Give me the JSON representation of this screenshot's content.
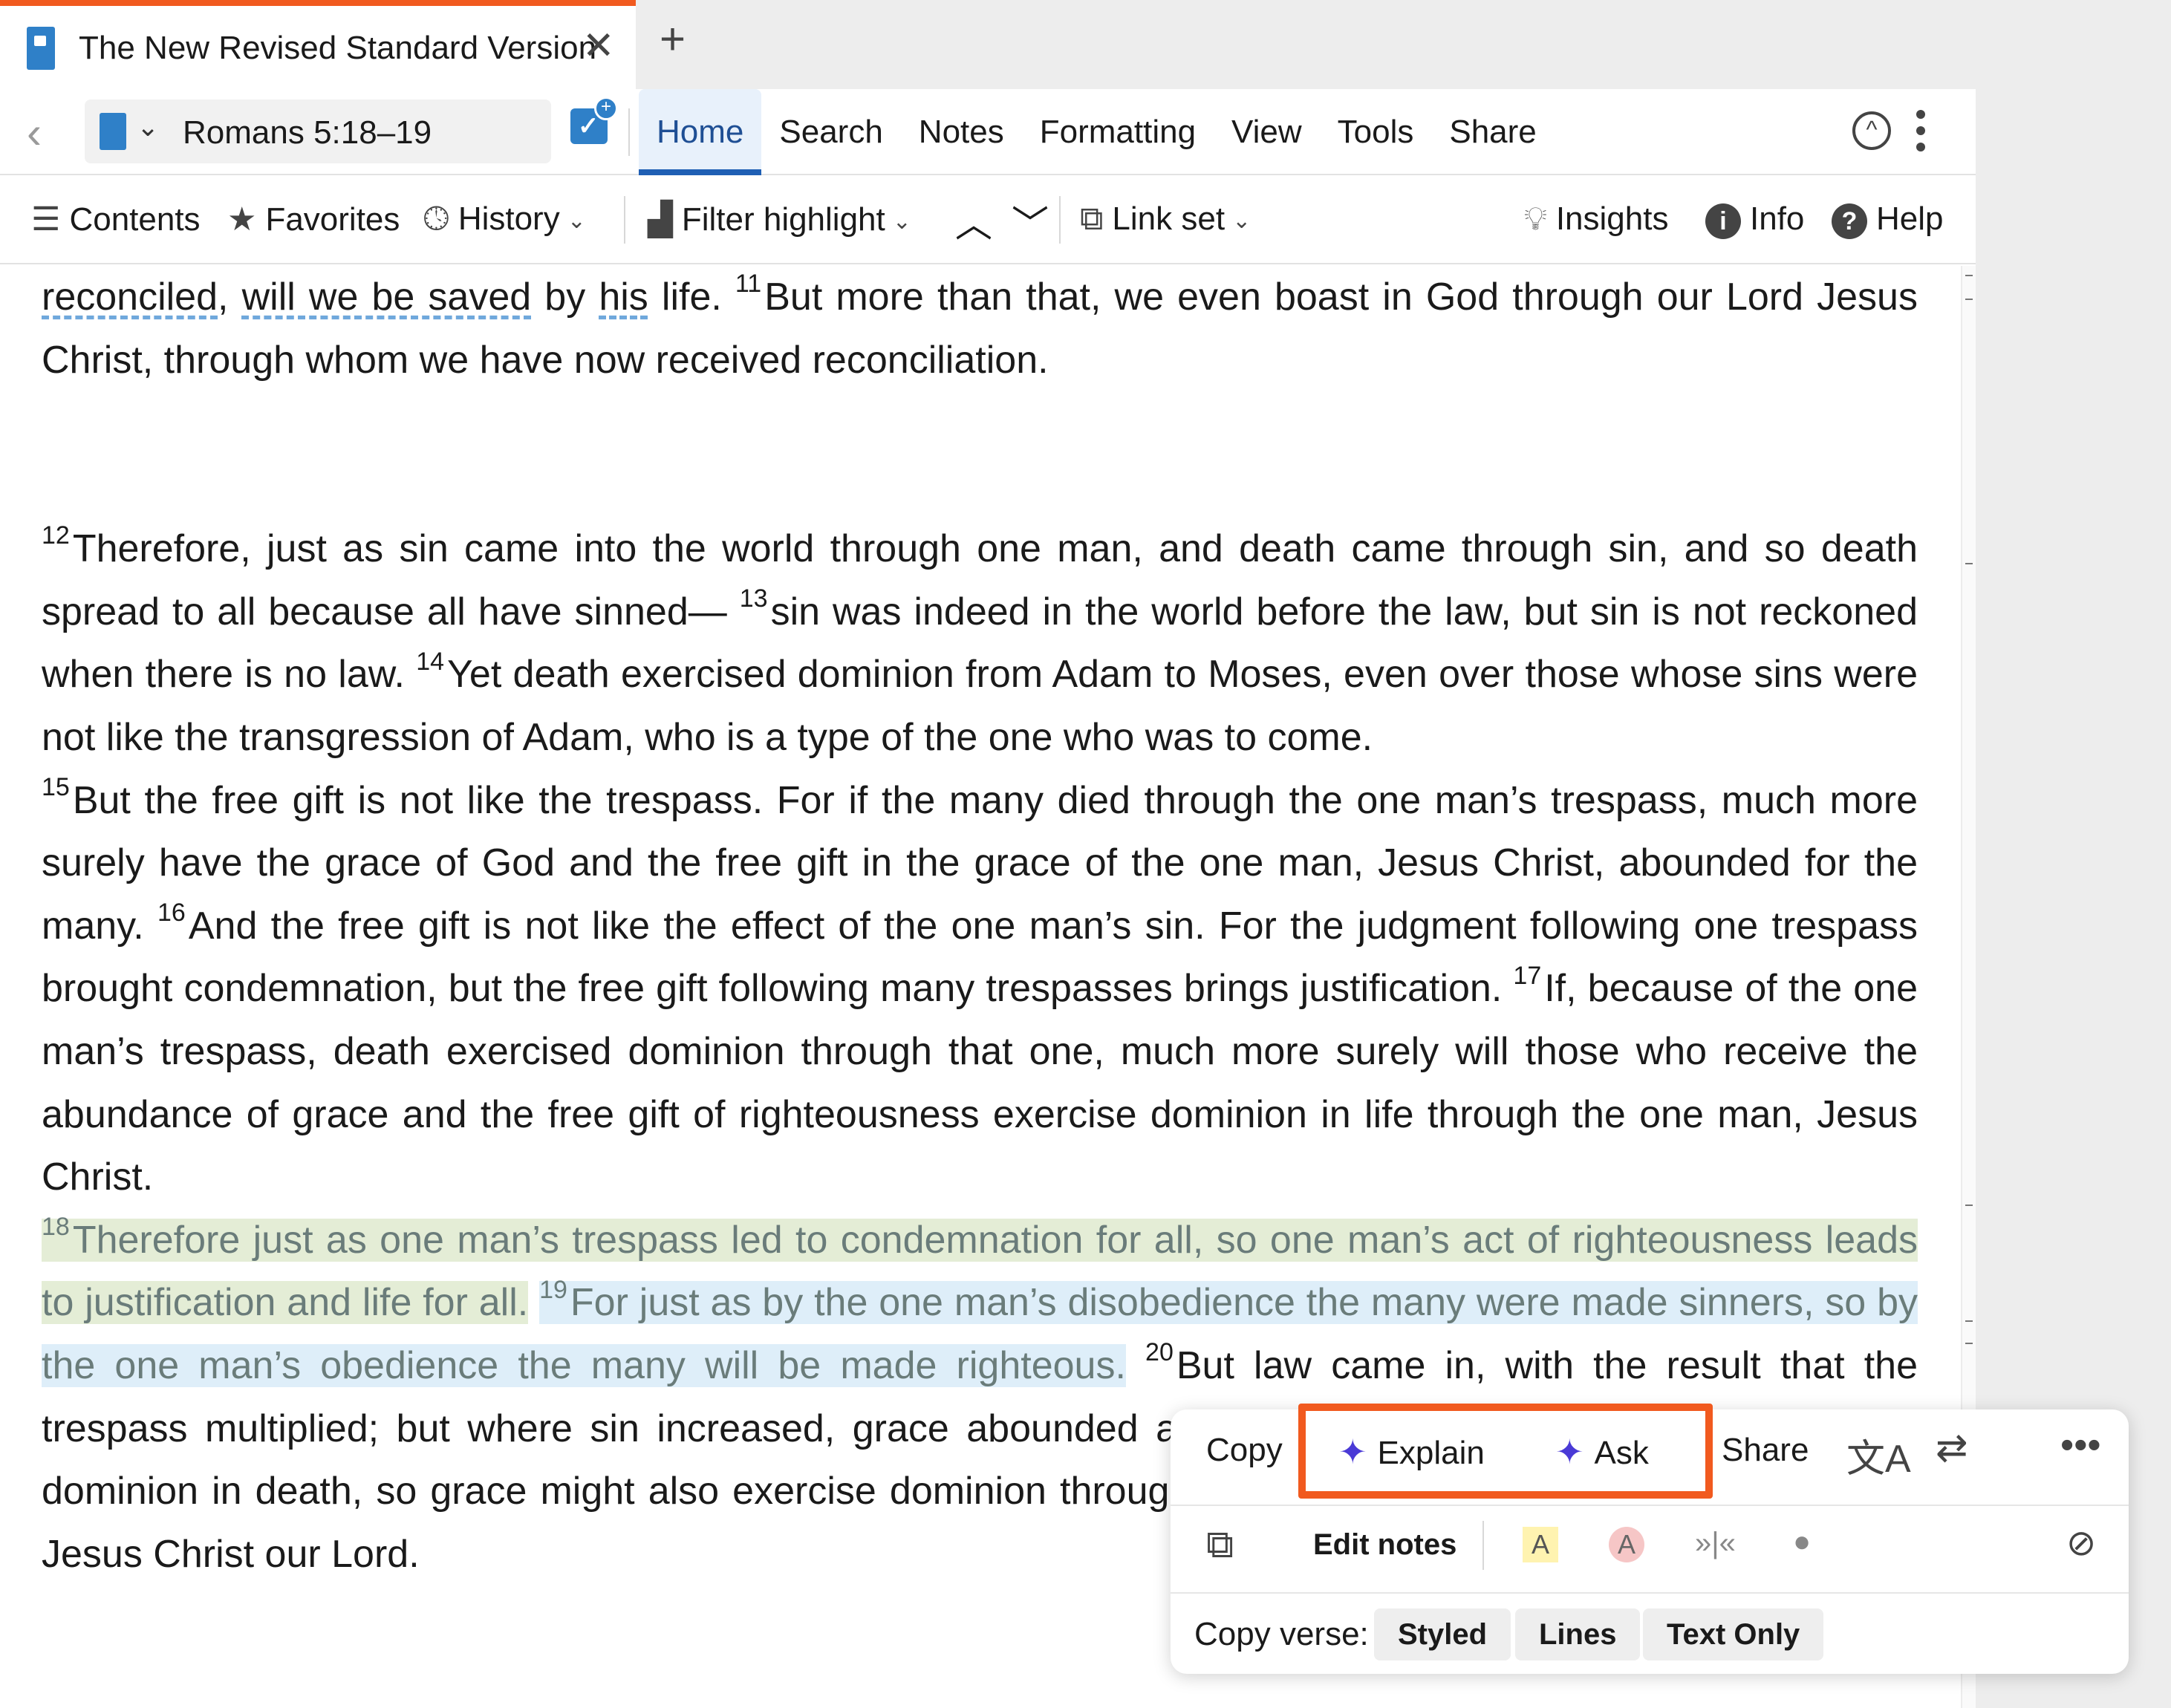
{
  "tab": {
    "title": "The New Revised Standard Version",
    "close": "✕",
    "new_tab": "+"
  },
  "toolbar": {
    "back": "‹",
    "reference": "Romans 5:18–19",
    "menu": [
      "Home",
      "Search",
      "Notes",
      "Formatting",
      "View",
      "Tools",
      "Share"
    ],
    "active_menu": "Home"
  },
  "toolbar2": {
    "contents": "Contents",
    "favorites": "Favorites",
    "history": "History",
    "filter_highlight": "Filter highlight",
    "link_set": "Link set",
    "insights": "Insights",
    "info": "Info",
    "help": "Help"
  },
  "verses": {
    "v11_tail_a": "reconciled",
    "v11_tail_b": ",",
    "v11_tail_c": "will we be saved",
    "v11_tail_d": " by ",
    "v11_tail_e": "his",
    "v11_tail_f": " life. ",
    "v11_num": "11",
    "v11_text": "But more than that, we even boast in God through our Lord Jesus Christ, through whom we have now received reconciliation.",
    "v12_num": "12",
    "v12_text": "Therefore, just as sin came into the world through one man, and death came through sin, and so death spread to all because all have sinned—",
    "v13_num": "13",
    "v13_text": "sin was indeed in the world before the law, but sin is not reckoned when there is no law.",
    "v14_num": "14",
    "v14_text": "Yet death exercised dominion from Adam to Moses, even over those whose sins were not like the transgression of Adam, who is a type of the one who was to come.",
    "v15_num": "15",
    "v15_text": "But the free gift is not like the trespass. For if the many died through the one man’s trespass, much more surely have the grace of God and the free gift in the grace of the one man, Jesus Christ, abounded for the many.",
    "v16_num": "16",
    "v16_text": "And the free gift is not like the effect of the one man’s sin. For the judgment following one trespass brought condemnation, but the free gift following many trespasses brings justification.",
    "v17_num": "17",
    "v17_text": "If, because of the one man’s trespass, death exercised dominion through that one, much more surely will those who receive the abundance of grace and the free gift of righteousness exercise dominion in life through the one man, Jesus Christ.",
    "v18_num": "18",
    "v18_text": "Therefore just as one man’s trespass led to condemnation for all, so one man’s act of righteousness leads to justification and life for all.",
    "v19_num": "19",
    "v19_text": "For just as by the one man’s disobedience the many were made sinners, so by the one man’s obedience the many will be made righteous.",
    "v20_num": "20",
    "v20_text": "But law came in, with the result that the trespass multiplied; but where sin increased, grace abounded all the more, so that, just as sin exercised dominion in death, so grace might also exercise dominion through justification leading to eternal life through Jesus Christ our Lord."
  },
  "popup": {
    "copy": "Copy",
    "explain": "Explain",
    "ask": "Ask",
    "share": "Share",
    "edit_notes": "Edit notes",
    "copy_verse_label": "Copy verse:",
    "styled": "Styled",
    "lines": "Lines",
    "text_only": "Text Only",
    "highlight_a": "A",
    "highlight_b": "A",
    "focus_color": "#f15a1f"
  },
  "colors": {
    "accent": "#f15a1f",
    "primary_blue": "#1f5fb4",
    "highlight_green": "#e4edd6",
    "highlight_blue": "#deeef9"
  }
}
